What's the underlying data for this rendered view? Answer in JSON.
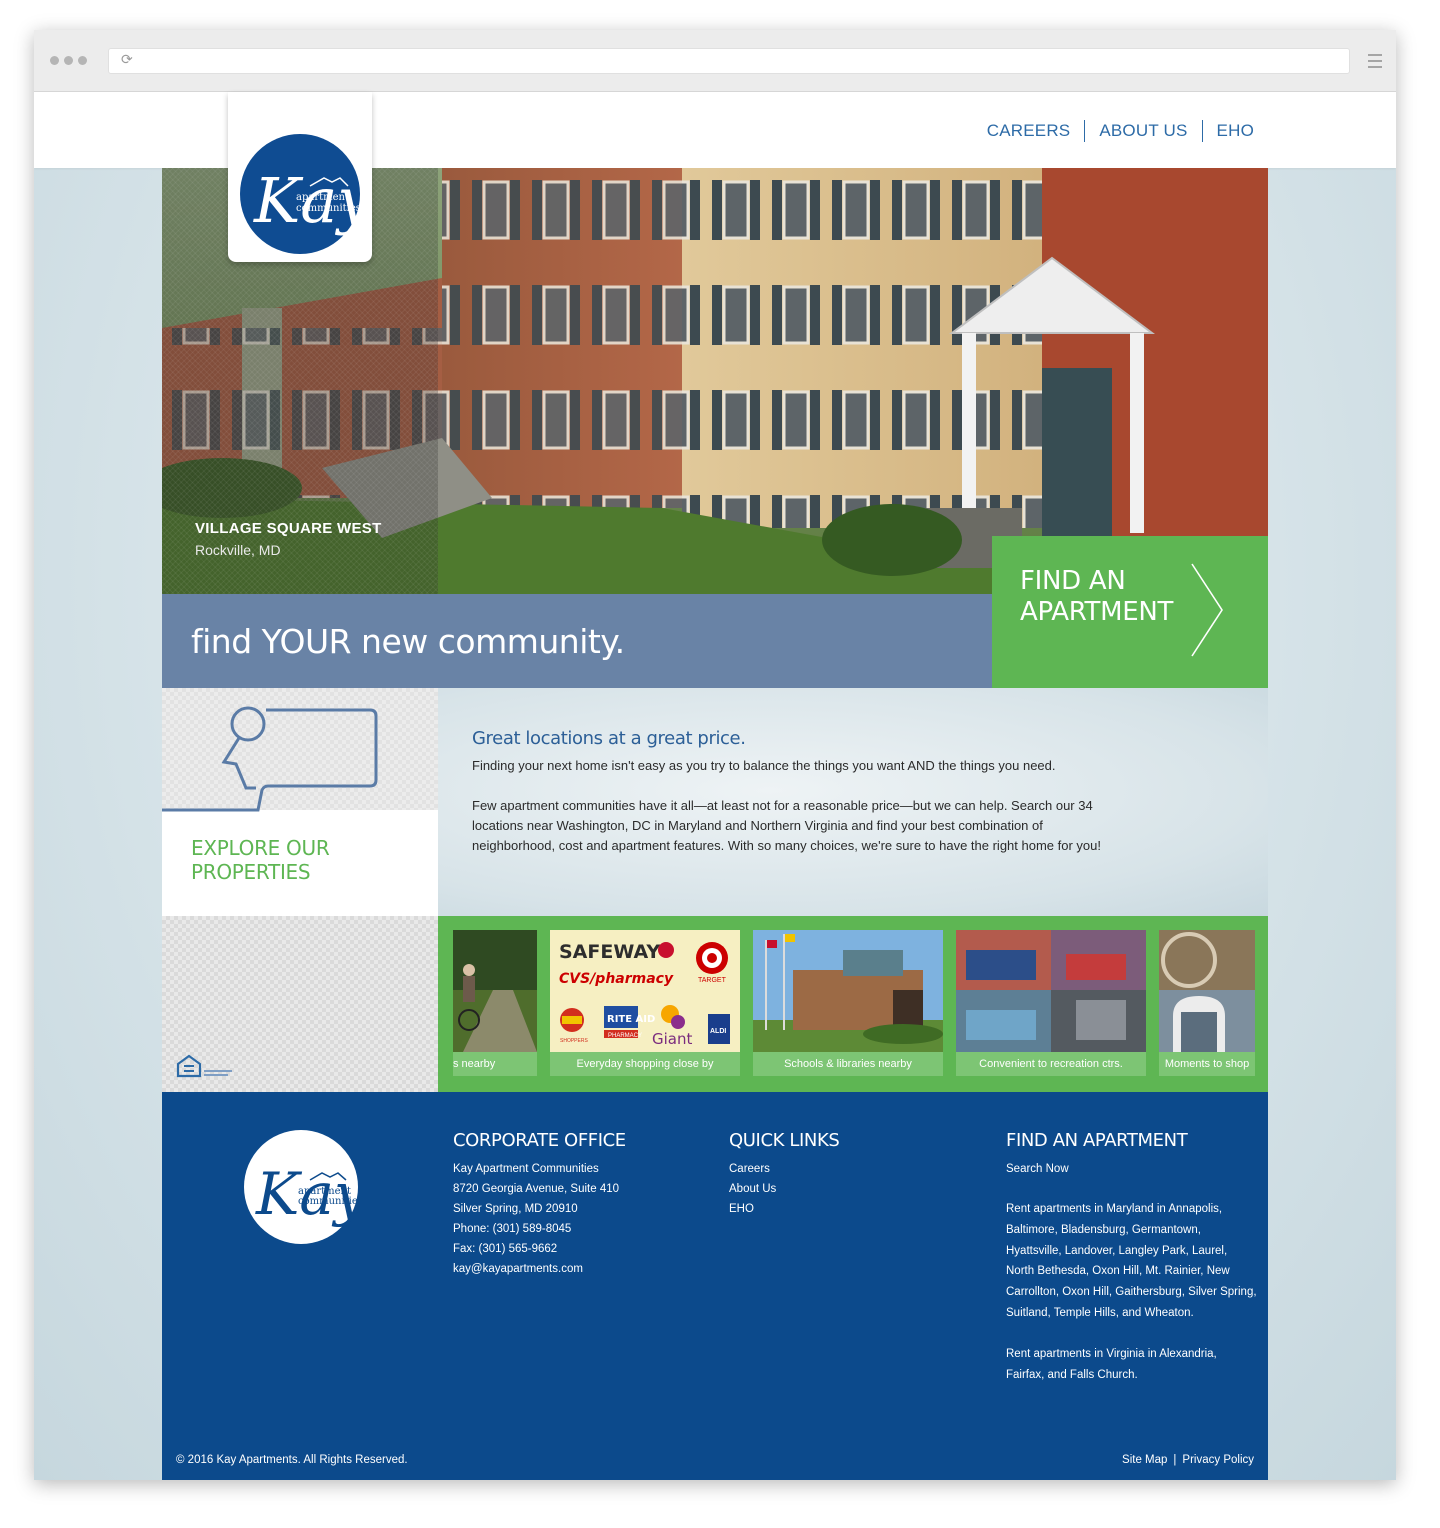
{
  "nav": {
    "careers": "CAREERS",
    "about_us": "ABOUT US",
    "eho": "EHO"
  },
  "logo": {
    "icon": "kay-logo-icon",
    "brand_initials": "Kay",
    "brand_line1": "apartment",
    "brand_line2": "communities"
  },
  "hero": {
    "property_name": "VILLAGE SQUARE WEST",
    "property_location": "Rockville, MD",
    "tagline": "find YOUR new community.",
    "cta_label": "FIND AN APARTMENT",
    "cta_icon": "chevron-right-icon"
  },
  "explore": {
    "label": "EXPLORE OUR PROPERTIES",
    "icon": "search-bubble-icon"
  },
  "intro": {
    "heading": "Great locations at a great price.",
    "paragraph1": "Finding your next home isn't easy as you try to balance the things you want AND the things you need.",
    "paragraph2": "Few apartment communities have it all—at least not for a reasonable price—but we can help. Search our 34 locations near Washington, DC in Maryland and Northern Virginia and find your best combination of neighborhood, cost and apartment features. With so many choices, we're sure to have the right home for you!"
  },
  "strip": {
    "eho_icon": "equal-housing-icon",
    "cards": [
      {
        "caption": "s nearby"
      },
      {
        "caption": "Everyday shopping close by",
        "logos": [
          "SAFEWAY",
          "CVS/pharmacy",
          "TARGET",
          "SHOPPERS",
          "RITE AID",
          "PHARMACY",
          "Giant",
          "ALDI"
        ]
      },
      {
        "caption": "Schools & libraries nearby"
      },
      {
        "caption": "Convenient to recreation ctrs."
      },
      {
        "caption": "Moments to shop"
      }
    ]
  },
  "footer": {
    "corporate": {
      "title": "CORPORATE OFFICE",
      "company": "Kay Apartment Communities",
      "address1": "8720 Georgia Avenue, Suite 410",
      "address2": "Silver Spring, MD 20910",
      "phone": "Phone: (301) 589-8045",
      "fax": "Fax: (301) 565-9662",
      "email": "kay@kayapartments.com"
    },
    "quick_links": {
      "title": "QUICK LINKS",
      "careers": "Careers",
      "about_us": "About Us",
      "eho": "EHO"
    },
    "find": {
      "title": "FIND AN APARTMENT",
      "search_now": "Search Now",
      "maryland": "Rent apartments in Maryland in Annapolis, Baltimore, Bladensburg, Germantown, Hyattsville, Landover, Langley Park, Laurel, North Bethesda, Oxon Hill, Mt. Rainier, New Carrollton, Oxon Hill, Gaithersburg, Silver Spring, Suitland, Temple Hills, and Wheaton.",
      "virginia": "Rent apartments in Virginia in Alexandria, Fairfax, and Falls Church."
    },
    "copyright": "© 2016 Kay Apartments. All Rights Reserved.",
    "site_map": "Site Map",
    "legal_sep": "|",
    "privacy": "Privacy Policy"
  },
  "colors": {
    "brand_blue": "#0c4a8c",
    "accent_green": "#5eb653",
    "tagline_blue": "#6983a6",
    "link_blue": "#2d6ba7"
  }
}
